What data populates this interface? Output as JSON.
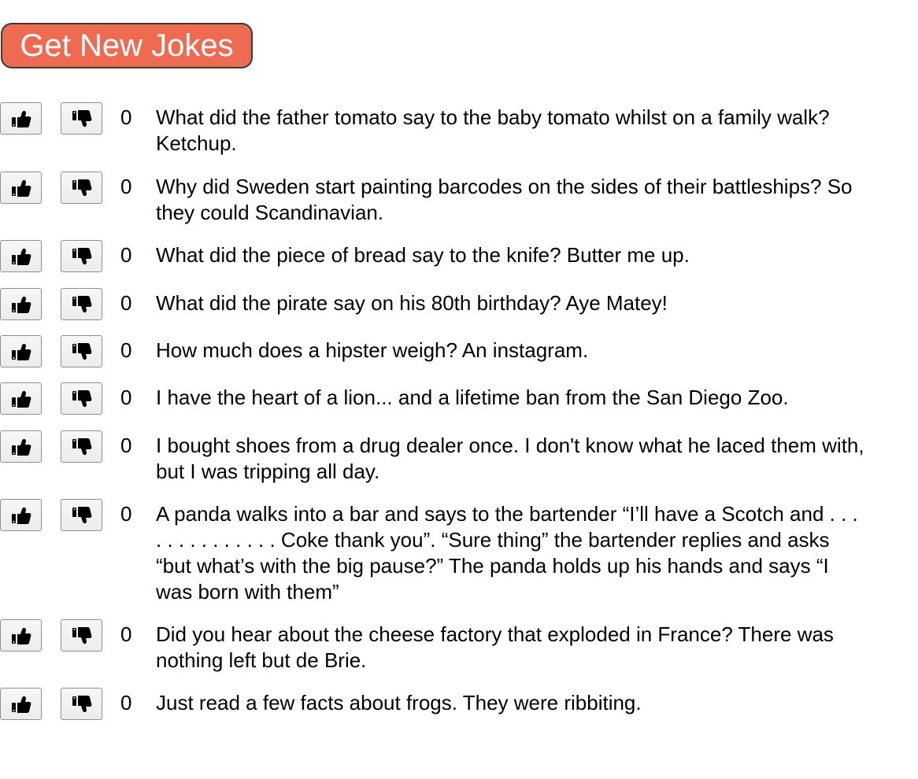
{
  "header": {
    "button_label": "Get New Jokes",
    "button_color": "#ee6b51"
  },
  "jokes": [
    {
      "score": "0",
      "text": "What did the father tomato say to the baby tomato whilst on a family walk? Ketchup."
    },
    {
      "score": "0",
      "text": "Why did Sweden start painting barcodes on the sides of their battleships? So they could Scandinavian."
    },
    {
      "score": "0",
      "text": "What did the piece of bread say to the knife? Butter me up."
    },
    {
      "score": "0",
      "text": "What did the pirate say on his 80th birthday? Aye Matey!"
    },
    {
      "score": "0",
      "text": "How much does a hipster weigh? An instagram."
    },
    {
      "score": "0",
      "text": "I have the heart of a lion... and a lifetime ban from the San Diego Zoo."
    },
    {
      "score": "0",
      "text": "I bought shoes from a drug dealer once. I don't know what he laced them with, but I was tripping all day."
    },
    {
      "score": "0",
      "text": "A panda walks into a bar and says to the bartender “I’ll have a Scotch and . . . . . . . . . . . . . . Coke thank you”. “Sure thing” the bartender replies and asks “but what’s with the big pause?” The panda holds up his hands and says “I was born with them”"
    },
    {
      "score": "0",
      "text": "Did you hear about the cheese factory that exploded in France? There was nothing left but de Brie."
    },
    {
      "score": "0",
      "text": "Just read a few facts about frogs. They were ribbiting."
    }
  ],
  "icons": {
    "upvote": "thumbs-up-icon",
    "downvote": "thumbs-down-icon"
  }
}
